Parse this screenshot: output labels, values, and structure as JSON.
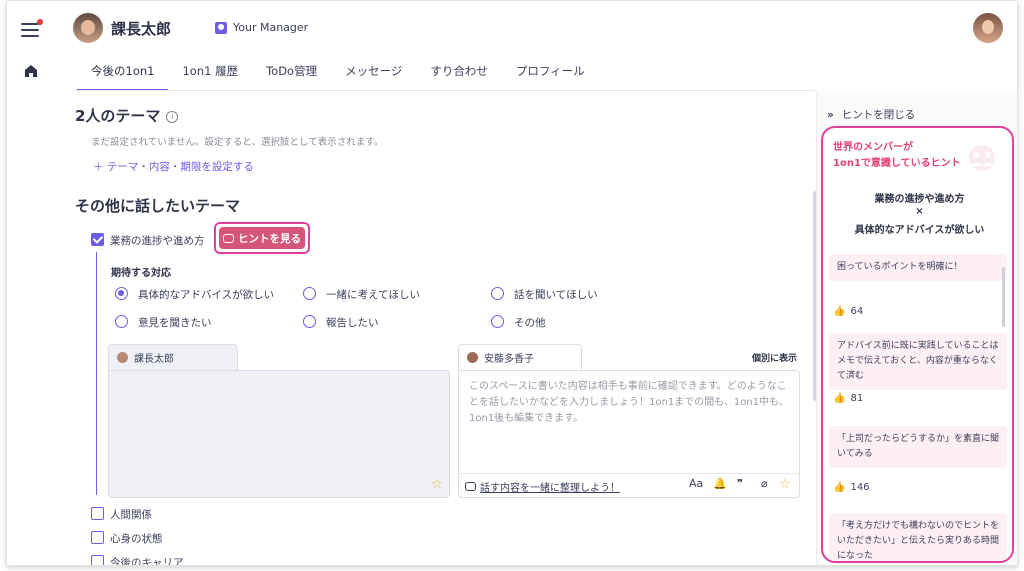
{
  "header": {
    "user_name": "課長太郎",
    "manager_label": "Your Manager"
  },
  "tabs": [
    {
      "label": "今後の1on1"
    },
    {
      "label": "1on1 履歴"
    },
    {
      "label": "ToDo管理"
    },
    {
      "label": "メッセージ"
    },
    {
      "label": "すり合わせ"
    },
    {
      "label": "プロフィール"
    }
  ],
  "theme_section": {
    "title": "2人のテーマ",
    "empty_text": "まだ設定されていません。設定すると、選択肢として表示されます。",
    "add_link": "＋  テーマ・内容・期限を設定する"
  },
  "other_section": {
    "title": "その他に話したいテーマ",
    "checked_item": "業務の進捗や進め方",
    "hint_button": "ヒントを見る",
    "expected_title": "期待する対応",
    "options": [
      {
        "label": "具体的なアドバイスが欲しい",
        "checked": true
      },
      {
        "label": "一緒に考えてほしい",
        "checked": false
      },
      {
        "label": "話を聞いてほしい",
        "checked": false
      },
      {
        "label": "意見を聞きたい",
        "checked": false
      },
      {
        "label": "報告したい",
        "checked": false
      },
      {
        "label": "その他",
        "checked": false
      }
    ],
    "left_pane_name": "課長太郎",
    "right_pane_name": "安藤多香子",
    "individual_toggle": "個別に表示",
    "placeholder": "このスペースに書いた内容は相手も事前に確認できます。どのようなことを話したいかなどを入力しましょう！1on1までの間も、1on1中も、1on1後も編集できます。",
    "organize_link": "話す内容を一緒に整理しよう！",
    "toolbar": {
      "font": "Aa",
      "bell": "🔔",
      "quote": "❞",
      "attach": "⌀",
      "star": "☆"
    },
    "more_items": [
      "人間関係",
      "心身の状態",
      "今後のキャリア"
    ]
  },
  "hint_panel": {
    "close_label": "ヒントを閉じる",
    "heading_line1": "世界のメンバーが",
    "heading_line2": "1on1で意識しているヒント",
    "topic_line1": "業務の進捗や進め方",
    "topic_line2": "×",
    "topic_line3": "具体的なアドバイスが欲しい",
    "tips": [
      {
        "text": "困っているポイントを明確に！",
        "likes": "64"
      },
      {
        "text": "アドバイス前に既に実践していることはメモで伝えておくと、内容が重ならなくて済む",
        "likes": "81"
      },
      {
        "text": "「上司だったらどうするか」を素直に聞いてみる",
        "likes": "146"
      },
      {
        "text": "「考え方だけでも構わないのでヒントをいただきたい」と伝えたら実りある時間になった",
        "likes": ""
      }
    ]
  },
  "colors": {
    "accent": "#6c5ce7",
    "hint_pink": "#e040a0",
    "hint_button": "#d6557a"
  }
}
